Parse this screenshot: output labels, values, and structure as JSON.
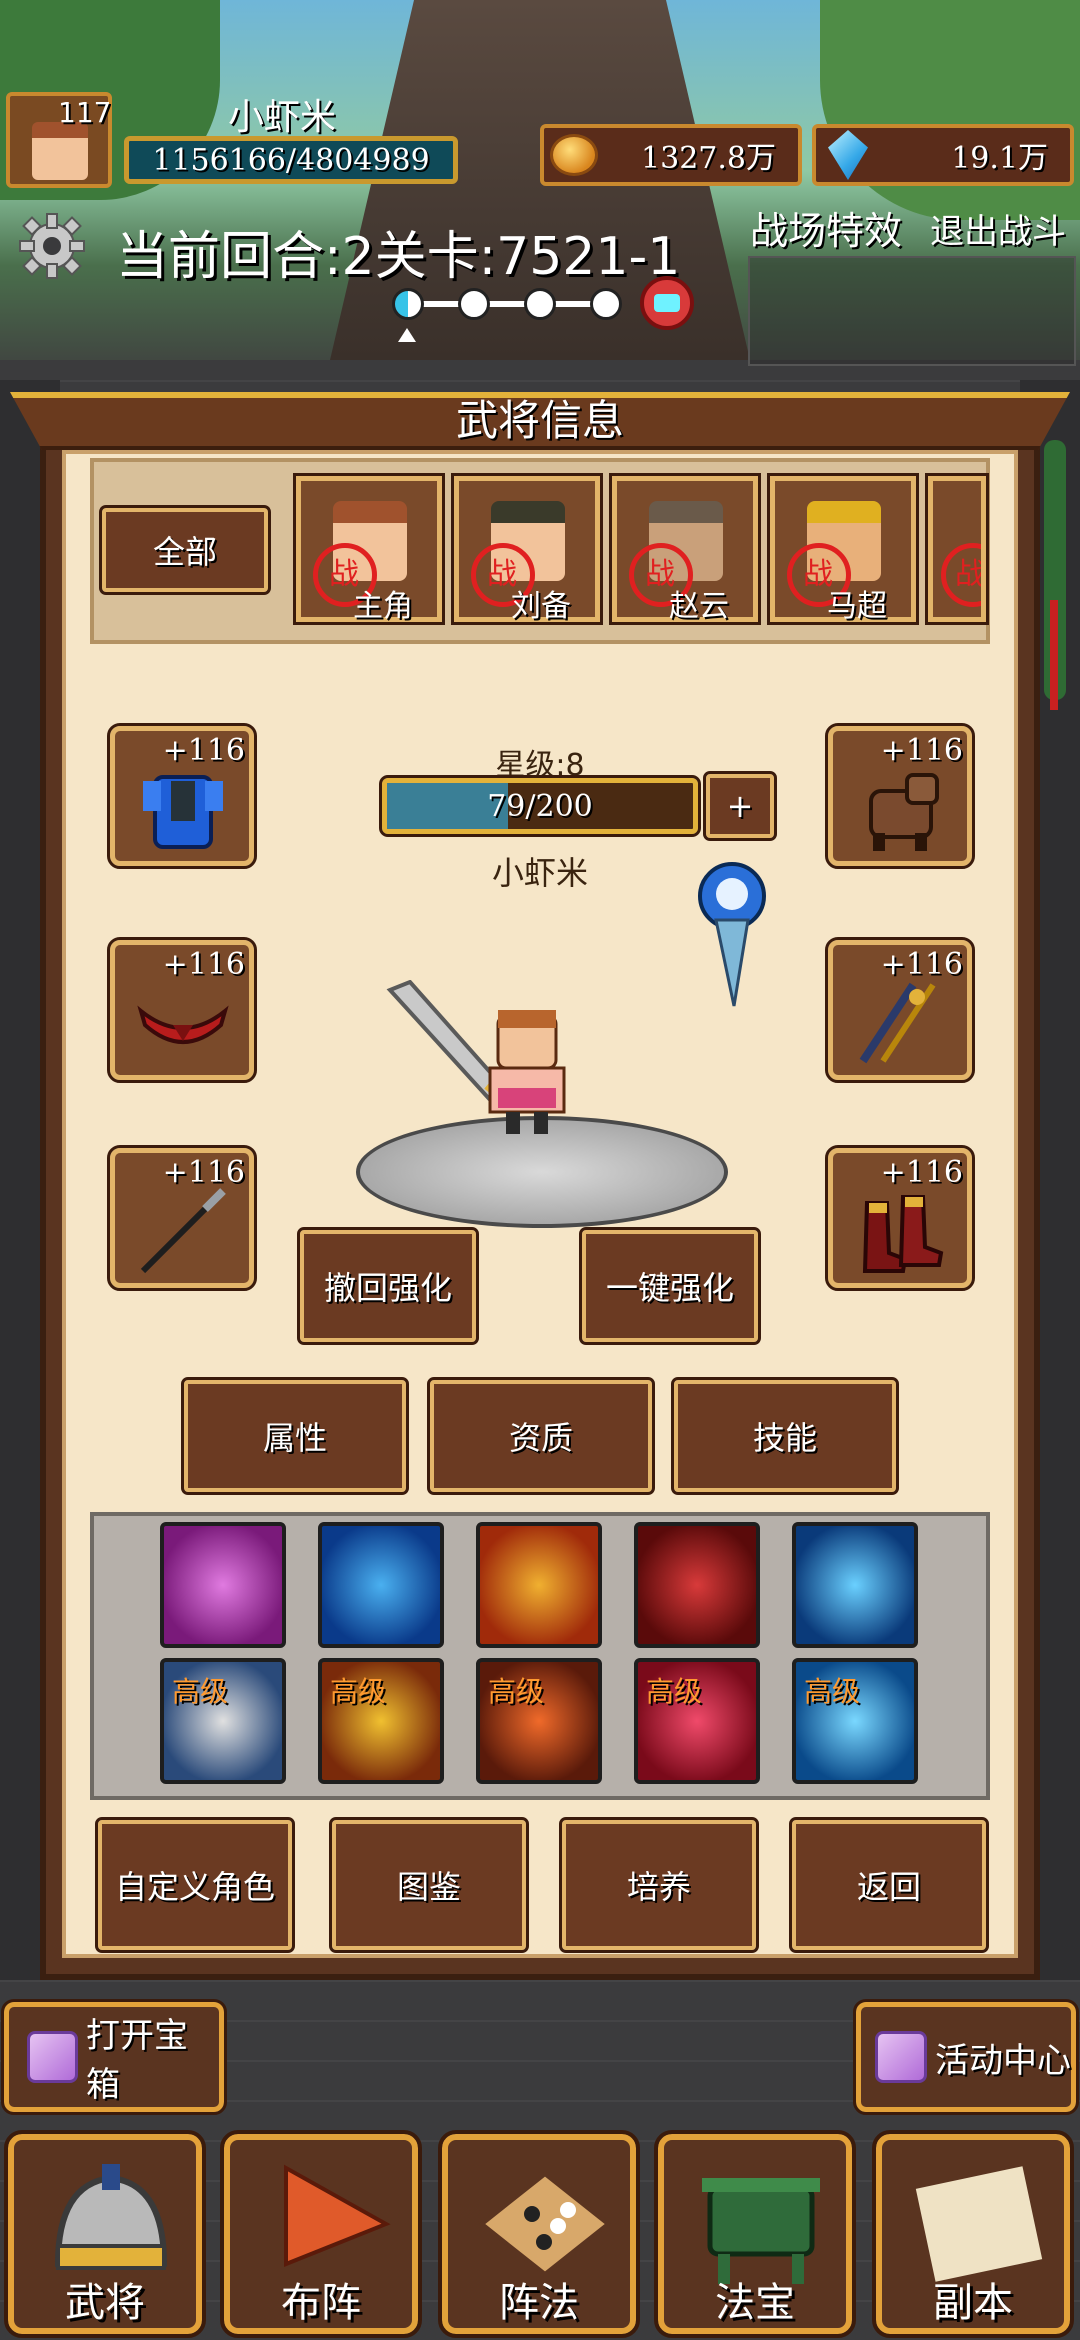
{
  "player": {
    "level": "117",
    "name": "小虾米",
    "exp_text": "1156166/4804989"
  },
  "resources": {
    "gold": "1327.8万",
    "gems": "19.1万"
  },
  "battle": {
    "round_text": "当前回合:2关卡:7521-1",
    "effects_label": "战场特效",
    "exit_label": "退出战斗"
  },
  "panel": {
    "title": "武将信息",
    "filter_all": "全部",
    "war_badge": "战",
    "heroes": [
      {
        "name": "主角",
        "color": "#f2c39b"
      },
      {
        "name": "刘备",
        "color": "#5c6b3a"
      },
      {
        "name": "赵云",
        "color": "#6a5a4a"
      },
      {
        "name": "马超",
        "color": "#e0b020"
      },
      {
        "name": "",
        "color": "#d83a3a"
      }
    ],
    "equip_bonus": [
      "+116",
      "+116",
      "+116",
      "+116",
      "+116",
      "+116"
    ],
    "star_level": "星级:8",
    "star_progress": {
      "text": "79/200",
      "current": 79,
      "max": 200
    },
    "star_plus": "+",
    "hero_name": "小虾米",
    "revert_button": "撤回强化",
    "auto_button": "一键强化",
    "tabs": [
      "属性",
      "资质",
      "技能"
    ],
    "skills_row1": [
      {
        "tag": "",
        "icon": "whirlwind-skill-icon"
      },
      {
        "tag": "",
        "icon": "ring-skill-icon"
      },
      {
        "tag": "",
        "icon": "shield-skill-icon"
      },
      {
        "tag": "",
        "icon": "claw-skill-icon"
      },
      {
        "tag": "",
        "icon": "frost-skill-icon"
      }
    ],
    "skills_row2": [
      {
        "tag": "高级",
        "icon": "sword-shield-skill-icon"
      },
      {
        "tag": "高级",
        "icon": "meteor-skill-icon"
      },
      {
        "tag": "高级",
        "icon": "rage-skill-icon"
      },
      {
        "tag": "高级",
        "icon": "heal-skill-icon"
      },
      {
        "tag": "高级",
        "icon": "ice-shield-skill-icon"
      }
    ],
    "bottom_buttons": [
      "自定义角色",
      "图鉴",
      "培养",
      "返回"
    ]
  },
  "side": {
    "open_chest": "打开宝箱",
    "activity_center": "活动中心"
  },
  "nav": [
    "武将",
    "布阵",
    "阵法",
    "法宝",
    "副本"
  ]
}
